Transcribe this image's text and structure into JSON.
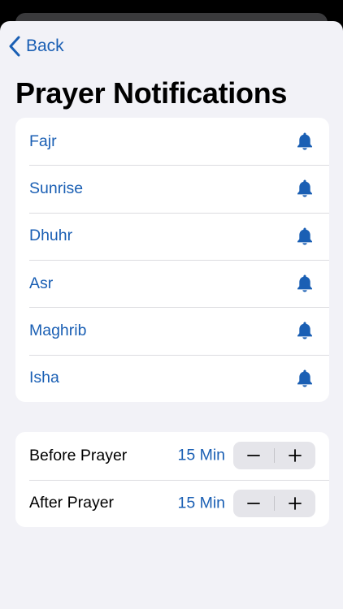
{
  "nav": {
    "back_label": "Back"
  },
  "page_title": "Prayer Notifications",
  "prayers": [
    {
      "name": "Fajr",
      "icon": "bell-icon"
    },
    {
      "name": "Sunrise",
      "icon": "bell-icon"
    },
    {
      "name": "Dhuhr",
      "icon": "bell-icon"
    },
    {
      "name": "Asr",
      "icon": "bell-icon"
    },
    {
      "name": "Maghrib",
      "icon": "bell-icon"
    },
    {
      "name": "Isha",
      "icon": "bell-icon"
    }
  ],
  "settings": {
    "before": {
      "label": "Before Prayer",
      "value": "15 Min"
    },
    "after": {
      "label": "After Prayer",
      "value": "15 Min"
    }
  },
  "colors": {
    "accent": "#1a5fb4",
    "background": "#f2f2f7",
    "card": "#ffffff",
    "stepper": "#e5e5ea"
  }
}
